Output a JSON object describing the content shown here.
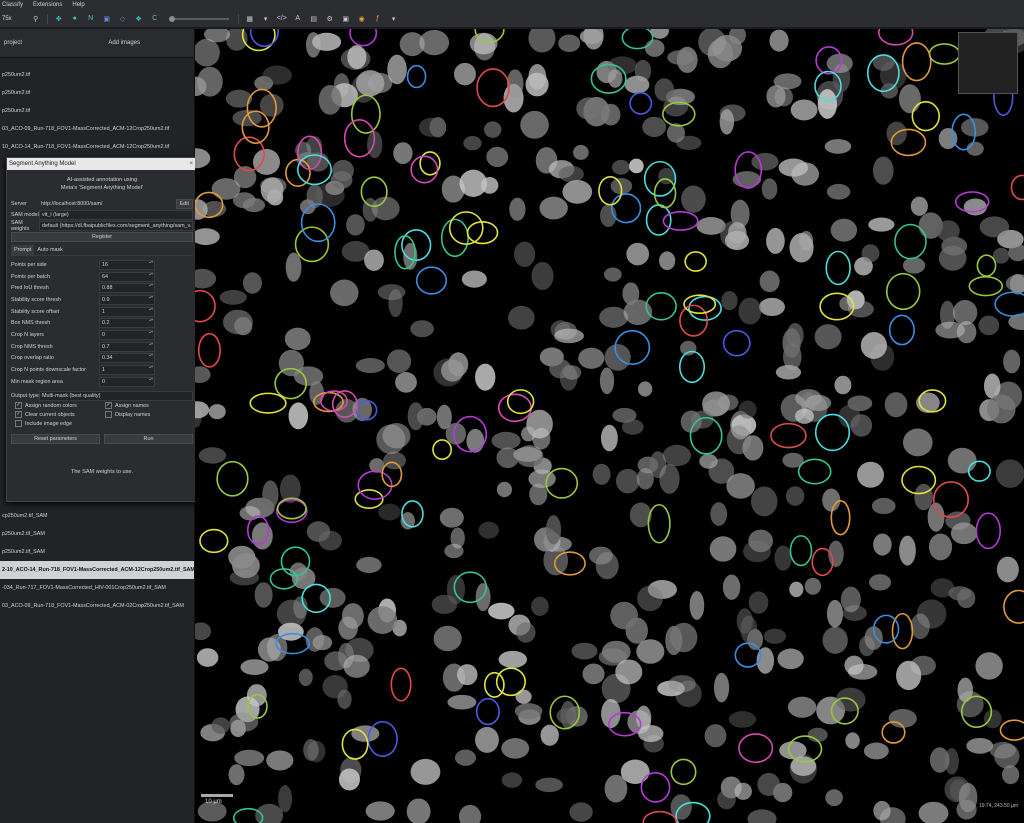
{
  "menubar": {
    "items": [
      "Classify",
      "Extensions",
      "Help"
    ]
  },
  "toolbar": {
    "zoom_text": "75x",
    "channel_text": "C"
  },
  "project": {
    "label": "project",
    "add_images": "Add images"
  },
  "images_top": [
    "p250um2.tif",
    "p250um2.tif",
    "p250um2.tif",
    "03_ACO-09_Run-718_FOV1-MassCorrected_ACM-12Crop250um2.tif",
    "10_ACO-14_Run-718_FOV1-MassCorrected_ACM-12Crop250um2.tif"
  ],
  "images_bottom": [
    "cp250um2.tif_SAM",
    "p250um2.tif_SAM",
    "p250um2.tif_SAM",
    "2-10_ACO-14_Run-718_FOV1-MassCorrected_ACM-12Crop250um2.tif_SAM",
    "-034_Run-717_FOV1-MassCorrected_HIV-001Crop250um2.tif_SAM",
    "03_ACO-09_Run-718_FOV1-MassCorrected_ACM-02Crop250um2.tif_SAM"
  ],
  "dialog": {
    "title": "Segment Anything Model",
    "close": "×",
    "intro1": "AI-assisted annotation using",
    "intro2": "Meta's 'Segment Anything Model'",
    "server_label": "Server",
    "server_value": "http://localhost:8000/sam/",
    "edit": "Edit",
    "model_label": "SAM model",
    "model_value": "vit_l (large)",
    "weights_label": "SAM weights",
    "weights_value": "default (https://dl.fbaipublicfiles.com/segment_anything/sam_v...",
    "register": "Register",
    "tab_prompt": "Prompt",
    "tab_automask": "Auto mask",
    "params": [
      {
        "label": "Points per side",
        "value": "16"
      },
      {
        "label": "Points per batch",
        "value": "64"
      },
      {
        "label": "Pred IoU thresh",
        "value": "0.88"
      },
      {
        "label": "Stability score thresh",
        "value": "0.9"
      },
      {
        "label": "Stability score offset",
        "value": "1"
      },
      {
        "label": "Box NMS thresh",
        "value": "0.2"
      },
      {
        "label": "Crop N layers",
        "value": "0"
      },
      {
        "label": "Crop NMS thresh",
        "value": "0.7"
      },
      {
        "label": "Crop overlap ratio",
        "value": "0.34"
      },
      {
        "label": "Crop N points downscale factor",
        "value": "1"
      },
      {
        "label": "Min mask region area",
        "value": "0"
      }
    ],
    "output_label": "Output type",
    "output_value": "Multi-mask (best quality)",
    "checks": [
      {
        "label": "Assign random colors",
        "checked": true
      },
      {
        "label": "Assign names",
        "checked": true
      },
      {
        "label": "Clear current objects",
        "checked": true
      },
      {
        "label": "Display names",
        "checked": false
      },
      {
        "label": "Include image edge",
        "checked": false
      }
    ],
    "reset": "Reset parameters",
    "run": "Run",
    "footer": "The SAM weights to use."
  },
  "viewer": {
    "scale_label": "10 µm",
    "coords": "19.74, 243.50 µm"
  }
}
